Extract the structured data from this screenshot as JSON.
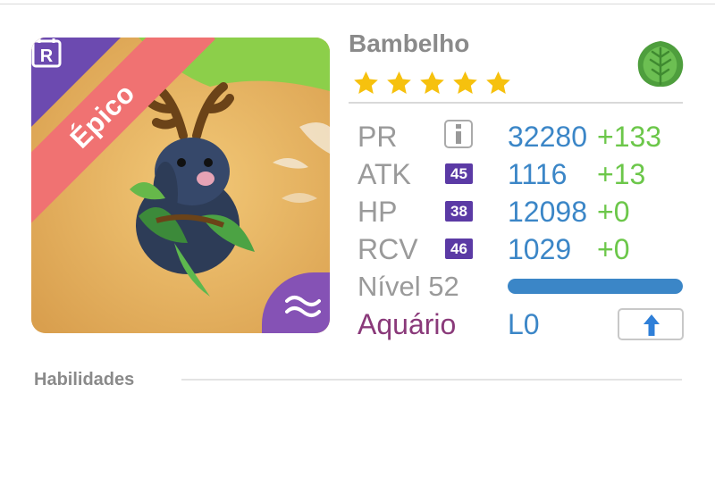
{
  "creature": {
    "rarity_label": "Épico",
    "rank_letter": "R",
    "element_symbol": "≈",
    "name": "Bambelho",
    "stars": 5,
    "type_icon": "leaf-icon"
  },
  "stats": {
    "pr": {
      "label": "PR",
      "base": "32280",
      "bonus": "+133"
    },
    "atk": {
      "label": "ATK",
      "level": "45",
      "base": "1116",
      "bonus": "+13"
    },
    "hp": {
      "label": "HP",
      "level": "38",
      "base": "12098",
      "bonus": "+0"
    },
    "rcv": {
      "label": "RCV",
      "level": "46",
      "base": "1029",
      "bonus": "+0"
    }
  },
  "level": {
    "label": "Nível 52",
    "progress": 1.0
  },
  "habitat": {
    "label": "Aquário",
    "value": "L0"
  },
  "sections": {
    "abilities": "Habilidades"
  },
  "colors": {
    "stat_blue": "#3b86c7",
    "bonus_green": "#6cc74a",
    "epic_ribbon": "#f07272",
    "purple": "#5b3aa5"
  }
}
